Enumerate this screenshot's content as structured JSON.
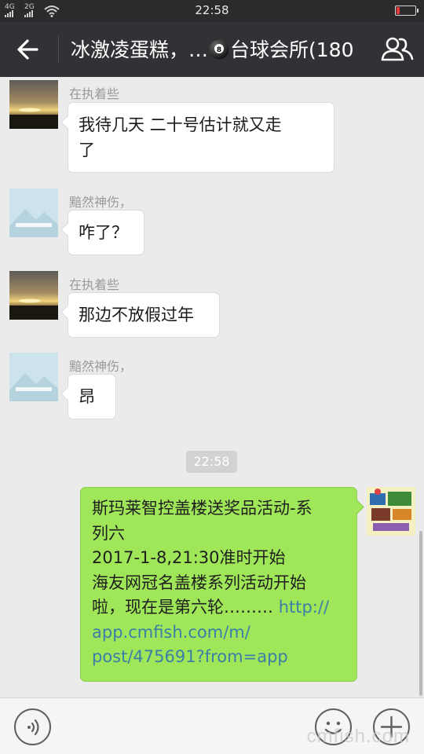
{
  "status_bar": {
    "time": "22:58",
    "sim1_label": "4G",
    "sim2_label": "2G",
    "battery_level": 0.2,
    "battery_color": "#e63c3c",
    "icons": [
      "signal-icon",
      "wifi-icon",
      "battery-icon"
    ]
  },
  "header": {
    "title": "冰激凌蛋糕，…🎱台球会所(180",
    "title_before_icon": "冰激凌蛋糕，…",
    "title_after_icon": "台球会所(180",
    "back_icon": "back-arrow-icon",
    "group_icon": "group-members-icon",
    "background": "#323236"
  },
  "messages": [
    {
      "sender": "在执着些",
      "text": "我待几天  二十号估计就又走了",
      "lines": [
        "我待几天  二十号估计就又走",
        "了"
      ],
      "direction": "incoming",
      "avatar": "sunset-avatar"
    },
    {
      "sender": "黯然神伤，",
      "text": "咋了？",
      "direction": "incoming",
      "avatar": "placeholder-avatar"
    },
    {
      "sender": "在执着些",
      "text": "那边不放假过年",
      "direction": "incoming",
      "avatar": "sunset-avatar"
    },
    {
      "sender": "黯然神伤，",
      "text": "昂",
      "direction": "incoming",
      "avatar": "placeholder-avatar"
    }
  ],
  "time_divider": "22:58",
  "outgoing_message": {
    "line1": "斯玛莱智控盖楼送奖品活动-系",
    "line2": "列六",
    "line3": "2017-1-8,21:30准时开始",
    "line4": "海友网冠名盖楼系列活动开始",
    "line5_text": "啦，现在是第六轮……… ",
    "line5_link": "http://",
    "line6": "app.cmfish.com/m/",
    "line7": "post/475691?from=app",
    "bubble_color": "#9fe658",
    "link_color": "#3c7ea8",
    "avatar": "promo-avatar"
  },
  "input_bar": {
    "voice_icon": "voice-icon",
    "emoji_icon": "emoji-icon",
    "more_icon": "plus-icon"
  },
  "watermark": "cmfish.com"
}
